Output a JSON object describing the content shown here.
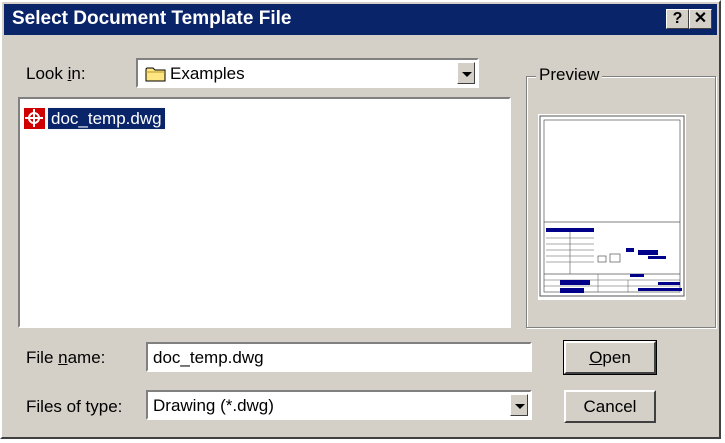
{
  "window": {
    "title": "Select Document Template File",
    "help_glyph": "?",
    "close_glyph": "✕"
  },
  "look_in": {
    "label_prefix": "Look ",
    "label_accel": "i",
    "label_suffix": "n:",
    "value": "Examples",
    "icon": "folder-icon"
  },
  "file_list": {
    "items": [
      {
        "name": "doc_temp.dwg",
        "icon": "dwg-file-icon",
        "selected": true
      }
    ]
  },
  "preview": {
    "label": "Preview"
  },
  "file_name": {
    "label_prefix": "File ",
    "label_accel": "n",
    "label_suffix": "ame:",
    "value": "doc_temp.dwg"
  },
  "files_of_type": {
    "label": "Files of type:",
    "value": "Drawing (*.dwg)"
  },
  "buttons": {
    "open_accel": "O",
    "open_rest": "pen",
    "cancel": "Cancel"
  },
  "colors": {
    "titlebar": "#0a246a",
    "face": "#d4d0c8",
    "selection": "#0a246a",
    "preview_accent": "#00008b"
  }
}
